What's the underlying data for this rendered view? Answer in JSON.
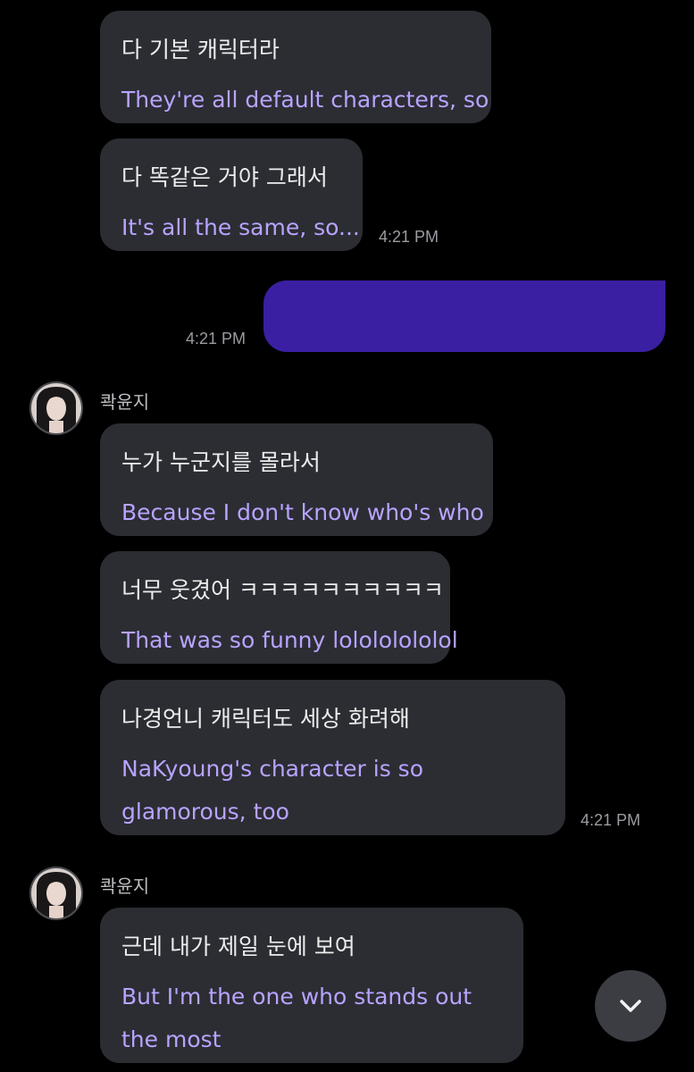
{
  "messages": [
    {
      "korean": "다 기본 캐릭터라",
      "english": "They're all default characters, so"
    },
    {
      "korean": "다 똑같은 거야 그래서",
      "english": "It's all the same, so...",
      "time": "4:21 PM"
    },
    {
      "korean": "누가 누군지를 몰라서",
      "english": "Because I don't know who's who"
    },
    {
      "korean": "너무 웃겼어 ㅋㅋㅋㅋㅋㅋㅋㅋㅋㅋ",
      "english": "That was so funny lolololololol"
    },
    {
      "korean": "나경언니 캐릭터도 세상 화려해",
      "english": "NaKyoung's character is so glamorous, too",
      "time": "4:21 PM"
    },
    {
      "korean": "근데 내가 제일 눈에 보여",
      "english": "But I'm the one who stands out the most"
    }
  ],
  "own_message": {
    "time": "4:21 PM",
    "color": "#3a1fa2"
  },
  "senders": [
    {
      "name": "콱윤지"
    },
    {
      "name": "콱윤지"
    }
  ],
  "scroll_button": {
    "icon": "chevron-down-icon"
  },
  "colors": {
    "background": "#000000",
    "bubble": "#2b2d33",
    "korean_text": "#ececec",
    "translation_text": "#b9a3ff",
    "timestamp": "#9b9ca2"
  }
}
